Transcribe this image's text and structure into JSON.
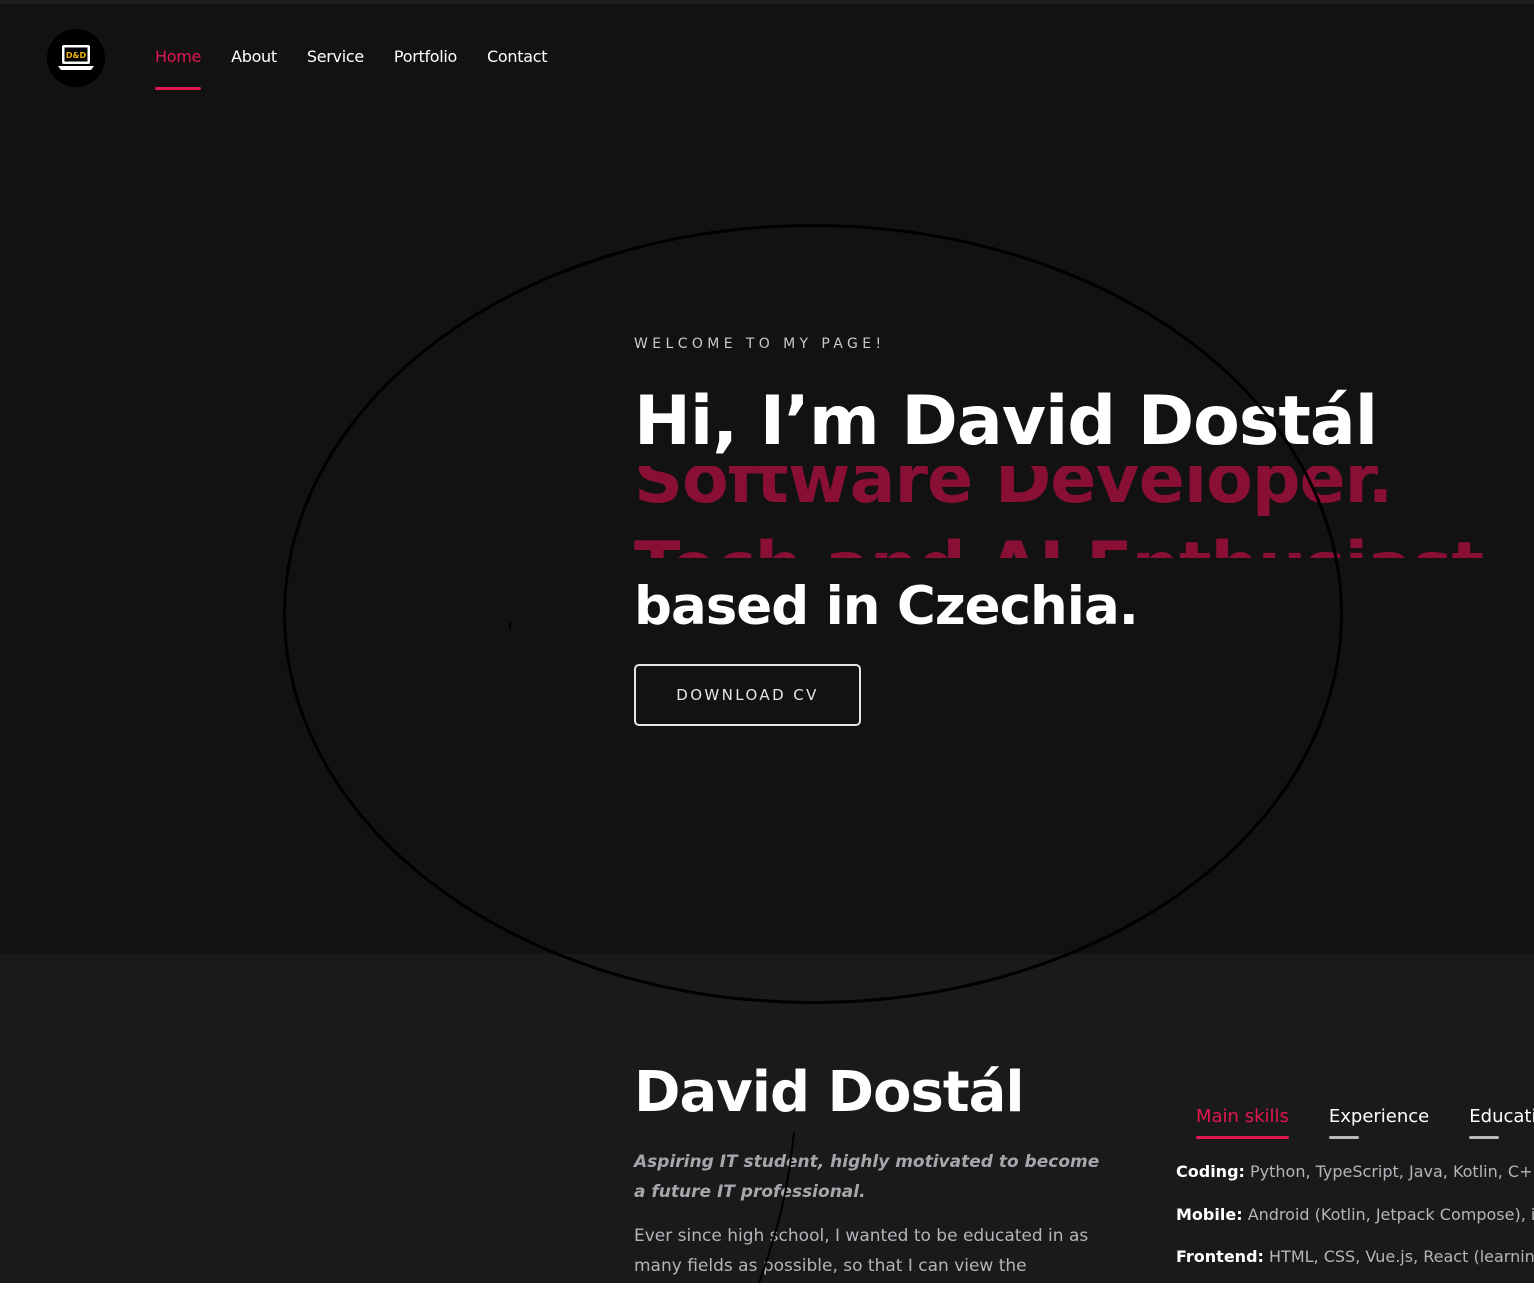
{
  "header": {
    "logo_text": "D&D",
    "nav": [
      {
        "label": "Home",
        "active": true
      },
      {
        "label": "About",
        "active": false
      },
      {
        "label": "Service",
        "active": false
      },
      {
        "label": "Portfolio",
        "active": false
      },
      {
        "label": "Contact",
        "active": false
      }
    ]
  },
  "hero": {
    "eyebrow": "WELCOME TO MY PAGE!",
    "title": "Hi, I’m David Dostál",
    "rotating_words": [
      "Software Developer.",
      "Tech and AI Enthusiast."
    ],
    "subtitle": "based in Czechia.",
    "cta_label": "DOWNLOAD CV"
  },
  "about": {
    "name": "David Dostál",
    "tagline": "Aspiring IT student, highly motivated to become a future IT professional.",
    "body": "Ever since high school, I wanted to be educated in as many fields as possible, so that I can view the",
    "tabs": [
      {
        "label": "Main skills",
        "active": true
      },
      {
        "label": "Experience",
        "active": false
      },
      {
        "label": "Education",
        "active": false
      }
    ],
    "skills": [
      {
        "label": "Coding:",
        "value": "Python, TypeScript, Java, Kotlin, C++, SQL"
      },
      {
        "label": "Mobile:",
        "value": "Android (Kotlin, Jetpack Compose), iOS"
      },
      {
        "label": "Frontend:",
        "value": "HTML, CSS, Vue.js, React (learning)"
      }
    ]
  },
  "colors": {
    "accent": "#e3174f",
    "accent_dark": "#8a0f34",
    "hero_bg": "#121212",
    "about_bg": "#1a1a1a"
  }
}
